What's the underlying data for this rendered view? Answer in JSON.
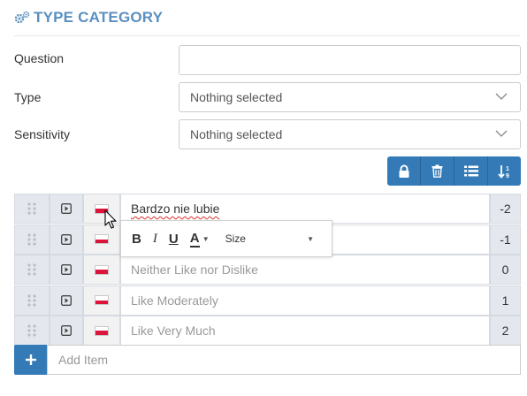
{
  "header": {
    "title": "TYPE CATEGORY",
    "icon": "gears-icon"
  },
  "form": {
    "question_label": "Question",
    "question_value": "",
    "type_label": "Type",
    "type_value": "Nothing selected",
    "sensitivity_label": "Sensitivity",
    "sensitivity_value": "Nothing selected"
  },
  "toolbar": {
    "buttons": [
      "lock-icon",
      "trash-icon",
      "list-icon",
      "sort-icon"
    ]
  },
  "items": [
    {
      "text": "Bardzo nie lubie",
      "placeholder": false,
      "value": "-2"
    },
    {
      "text": "",
      "placeholder": false,
      "value": "-1"
    },
    {
      "text": "Neither Like nor Dislike",
      "placeholder": true,
      "value": "0"
    },
    {
      "text": "Like Moderately",
      "placeholder": true,
      "value": "1"
    },
    {
      "text": "Like Very Much",
      "placeholder": true,
      "value": "2"
    }
  ],
  "add_item": {
    "placeholder": "Add Item",
    "button": "+"
  },
  "format_bar": {
    "bold": "B",
    "italic": "I",
    "underline": "U",
    "font_color": "A",
    "size_label": "Size"
  },
  "colors": {
    "accent": "#337ab7",
    "header": "#5a8fc0"
  }
}
